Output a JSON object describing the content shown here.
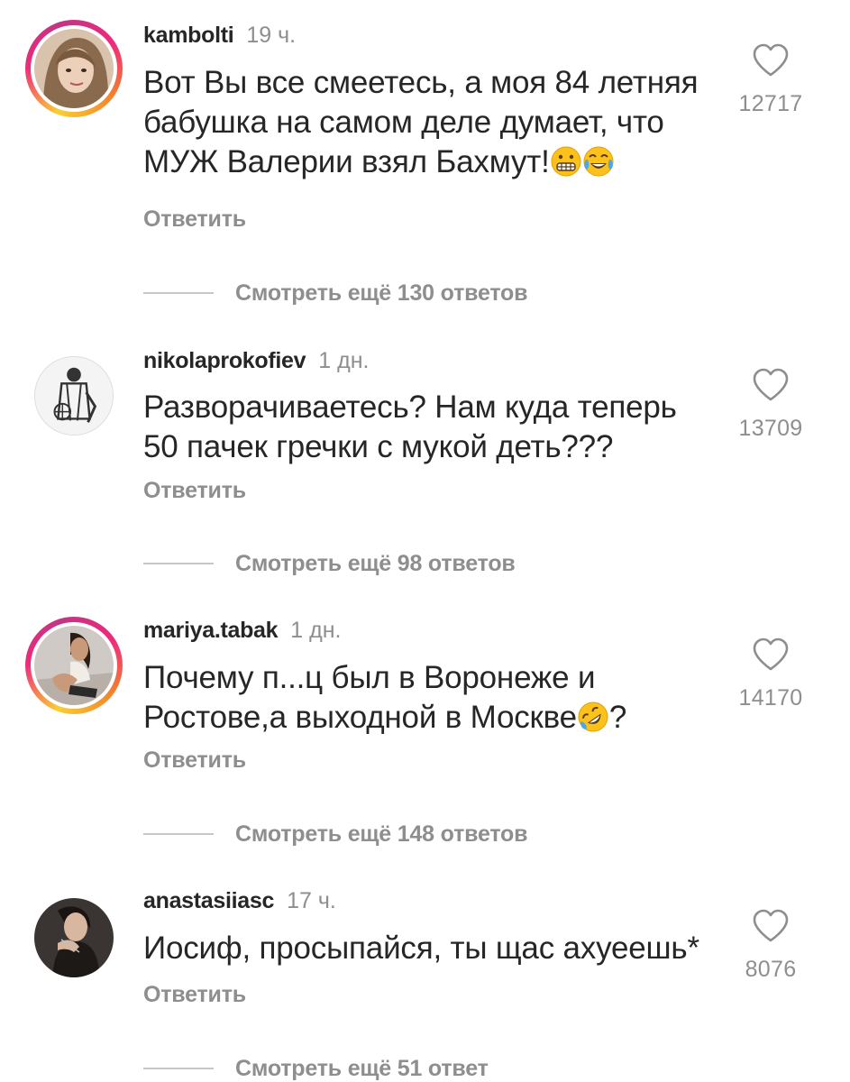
{
  "comments": [
    {
      "username": "kambolti",
      "time": "19 ч.",
      "text_lines": [
        "Вот Вы все смеетесь, а моя 84 летняя",
        "бабушка на самом деле думает, что",
        "МУЖ Валерии взял Бахмут!"
      ],
      "emoji": [
        "grimacing-face",
        "face-with-tears-of-joy"
      ],
      "reply_label": "Ответить",
      "likes": "12717",
      "view_replies": "Смотреть ещё 130 ответов",
      "story_ring": true
    },
    {
      "username": "nikolaprokofiev",
      "time": "1 дн.",
      "text_lines": [
        "Разворачиваетесь? Нам куда теперь",
        "50 пачек гречки с мукой деть???"
      ],
      "reply_label": "Ответить",
      "likes": "13709",
      "view_replies": "Смотреть ещё 98 ответов",
      "story_ring": false
    },
    {
      "username": "mariya.tabak",
      "time": "1 дн.",
      "text_line1": "Почему п...ц был в Воронеже и",
      "text_line2_before": "Ростове,а выходной в Москве",
      "text_line2_after": "?",
      "emoji": [
        "rolling-on-floor-laughing"
      ],
      "reply_label": "Ответить",
      "likes": "14170",
      "view_replies": "Смотреть ещё 148 ответов",
      "story_ring": true
    },
    {
      "username": "anastasiiasc",
      "time": "17 ч.",
      "text_lines": [
        "Иосиф, просыпайся, ты щас ахуеешь*"
      ],
      "reply_label": "Ответить",
      "likes": "8076",
      "view_replies": "Смотреть ещё 51 ответ",
      "story_ring": false
    }
  ],
  "colors": {
    "text": "#262626",
    "muted": "#8e8e8e",
    "divider": "#c7c7c7"
  }
}
